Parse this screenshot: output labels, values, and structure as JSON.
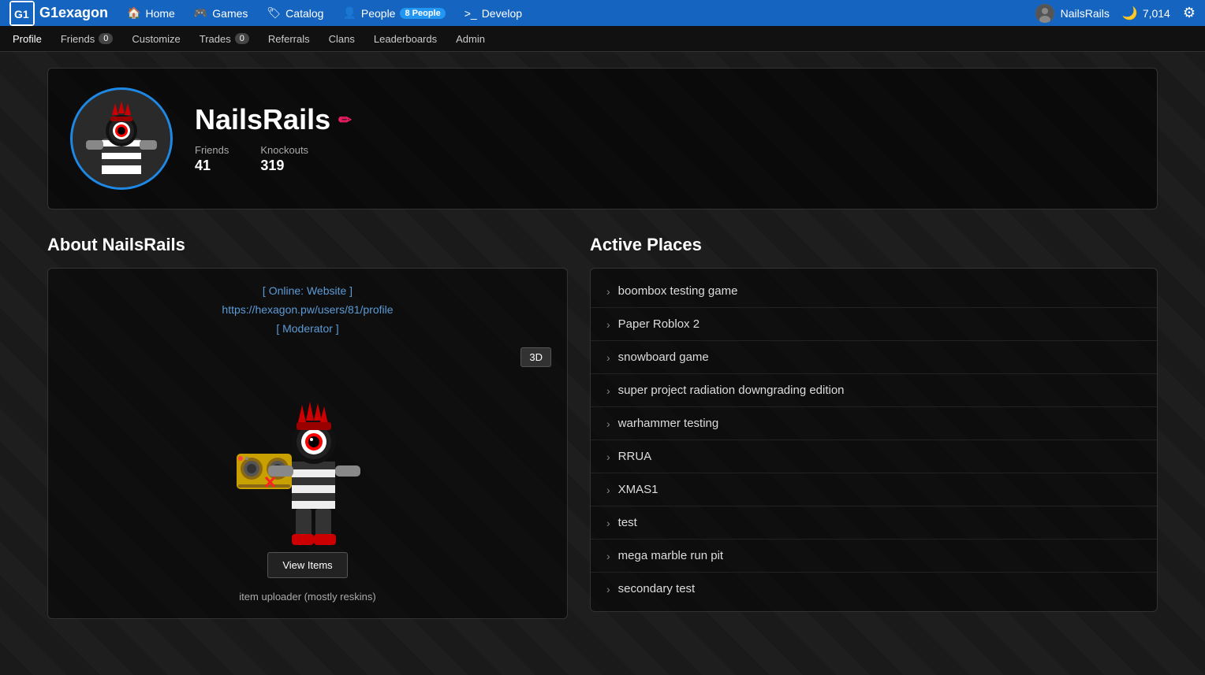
{
  "topNav": {
    "logo": "G1exagon",
    "logoText": "G1exagon",
    "items": [
      {
        "label": "Home",
        "icon": "home-icon"
      },
      {
        "label": "Games",
        "icon": "games-icon"
      },
      {
        "label": "Catalog",
        "icon": "catalog-icon"
      },
      {
        "label": "People",
        "icon": "people-icon",
        "badge": "8 People"
      },
      {
        "label": "Develop",
        "icon": "develop-icon"
      }
    ],
    "username": "NailsRails",
    "currency": "7,014",
    "settingsIcon": "gear-icon"
  },
  "subNav": {
    "items": [
      {
        "label": "Profile",
        "active": true
      },
      {
        "label": "Friends",
        "badge": "0"
      },
      {
        "label": "Customize"
      },
      {
        "label": "Trades",
        "badge": "0"
      },
      {
        "label": "Referrals"
      },
      {
        "label": "Clans"
      },
      {
        "label": "Leaderboards"
      },
      {
        "label": "Admin"
      }
    ]
  },
  "profile": {
    "username": "NailsRails",
    "editIcon": "✏",
    "stats": {
      "friends": {
        "label": "Friends",
        "value": "41"
      },
      "knockouts": {
        "label": "Knockouts",
        "value": "319"
      }
    }
  },
  "about": {
    "sectionTitle": "About NailsRails",
    "online": "[ Online: Website ]",
    "link": "https://hexagon.pw/users/81/profile",
    "moderator": "[ Moderator ]",
    "btn3d": "3D",
    "viewItemsBtn": "View Items",
    "description": "item uploader (mostly reskins)"
  },
  "activePlaces": {
    "sectionTitle": "Active Places",
    "items": [
      {
        "label": "boombox testing game"
      },
      {
        "label": "Paper Roblox 2"
      },
      {
        "label": "snowboard game"
      },
      {
        "label": "super project radiation downgrading edition"
      },
      {
        "label": "warhammer testing"
      },
      {
        "label": "RRUA"
      },
      {
        "label": "XMAS1"
      },
      {
        "label": "test"
      },
      {
        "label": "mega marble run pit"
      },
      {
        "label": "secondary test"
      }
    ]
  }
}
